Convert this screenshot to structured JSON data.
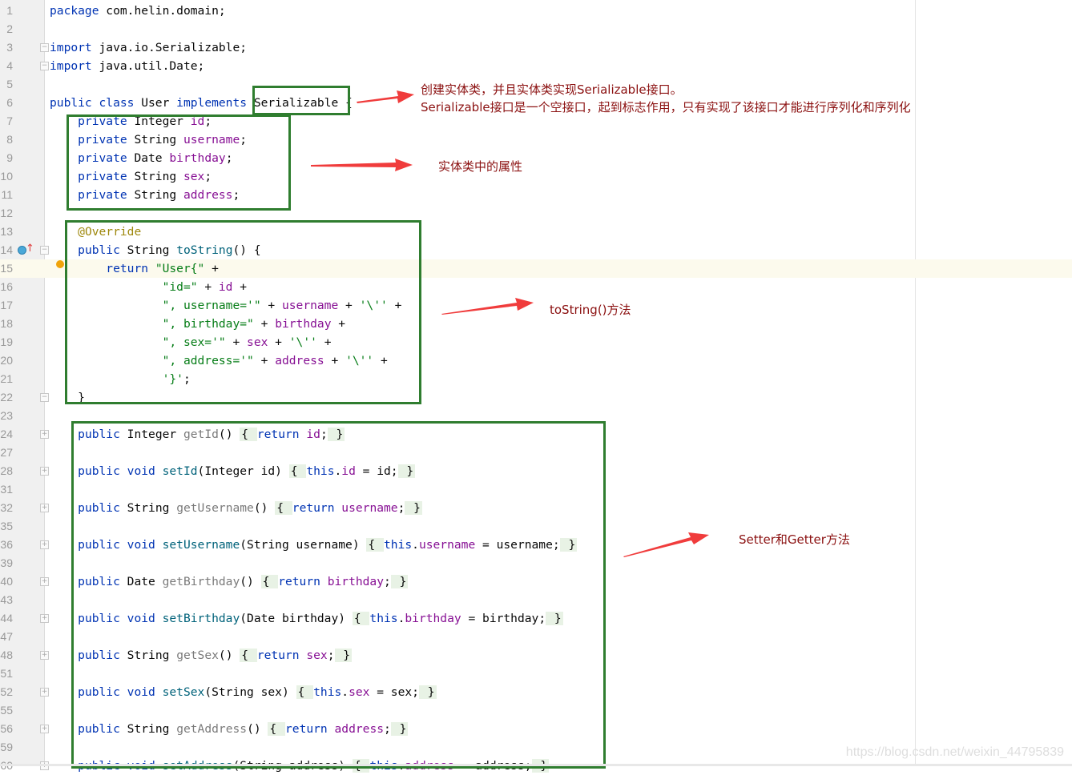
{
  "editor": {
    "caret_line": "15",
    "lines": [
      {
        "n": "1",
        "t": [
          [
            "k",
            "package "
          ],
          [
            "p",
            "com.helin.domain;"
          ]
        ]
      },
      {
        "n": "2",
        "t": []
      },
      {
        "n": "3",
        "fold": "-",
        "t": [
          [
            "k",
            "import "
          ],
          [
            "p",
            "java.io.Serializable;"
          ]
        ]
      },
      {
        "n": "4",
        "fold": "-",
        "t": [
          [
            "k",
            "import "
          ],
          [
            "p",
            "java.util.Date;"
          ]
        ]
      },
      {
        "n": "5",
        "t": []
      },
      {
        "n": "6",
        "t": [
          [
            "k",
            "public class "
          ],
          [
            "p",
            "User "
          ],
          [
            "k",
            "implements "
          ],
          [
            "p",
            "Serializable {"
          ]
        ]
      },
      {
        "n": "7",
        "t": [
          [
            "p",
            "    "
          ],
          [
            "k",
            "private "
          ],
          [
            "p",
            "Integer "
          ],
          [
            "f",
            "id"
          ],
          [
            "p",
            ";"
          ]
        ]
      },
      {
        "n": "8",
        "t": [
          [
            "p",
            "    "
          ],
          [
            "k",
            "private "
          ],
          [
            "p",
            "String "
          ],
          [
            "f",
            "username"
          ],
          [
            "p",
            ";"
          ]
        ]
      },
      {
        "n": "9",
        "t": [
          [
            "p",
            "    "
          ],
          [
            "k",
            "private "
          ],
          [
            "p",
            "Date "
          ],
          [
            "f",
            "birthday"
          ],
          [
            "p",
            ";"
          ]
        ]
      },
      {
        "n": "10",
        "t": [
          [
            "p",
            "    "
          ],
          [
            "k",
            "private "
          ],
          [
            "p",
            "String "
          ],
          [
            "f",
            "sex"
          ],
          [
            "p",
            ";"
          ]
        ]
      },
      {
        "n": "11",
        "t": [
          [
            "p",
            "    "
          ],
          [
            "k",
            "private "
          ],
          [
            "p",
            "String "
          ],
          [
            "f",
            "address"
          ],
          [
            "p",
            ";"
          ]
        ]
      },
      {
        "n": "12",
        "t": []
      },
      {
        "n": "13",
        "t": [
          [
            "p",
            "    "
          ],
          [
            "a",
            "@Override"
          ]
        ]
      },
      {
        "n": "14",
        "fold": "-",
        "t": [
          [
            "p",
            "    "
          ],
          [
            "k",
            "public "
          ],
          [
            "p",
            "String "
          ],
          [
            "m",
            "toString"
          ],
          [
            "p",
            "() {"
          ]
        ]
      },
      {
        "n": "15",
        "t": [
          [
            "p",
            "        "
          ],
          [
            "k",
            "return "
          ],
          [
            "s",
            "\"User{\""
          ],
          [
            "p",
            " +"
          ]
        ]
      },
      {
        "n": "16",
        "t": [
          [
            "p",
            "                "
          ],
          [
            "s",
            "\"id=\""
          ],
          [
            "p",
            " + "
          ],
          [
            "f",
            "id"
          ],
          [
            "p",
            " +"
          ]
        ]
      },
      {
        "n": "17",
        "t": [
          [
            "p",
            "                "
          ],
          [
            "s",
            "\", username='\""
          ],
          [
            "p",
            " + "
          ],
          [
            "f",
            "username"
          ],
          [
            "p",
            " + "
          ],
          [
            "s",
            "'\\''"
          ],
          [
            "p",
            " +"
          ]
        ]
      },
      {
        "n": "18",
        "t": [
          [
            "p",
            "                "
          ],
          [
            "s",
            "\", birthday=\""
          ],
          [
            "p",
            " + "
          ],
          [
            "f",
            "birthday"
          ],
          [
            "p",
            " +"
          ]
        ]
      },
      {
        "n": "19",
        "t": [
          [
            "p",
            "                "
          ],
          [
            "s",
            "\", sex='\""
          ],
          [
            "p",
            " + "
          ],
          [
            "f",
            "sex"
          ],
          [
            "p",
            " + "
          ],
          [
            "s",
            "'\\''"
          ],
          [
            "p",
            " +"
          ]
        ]
      },
      {
        "n": "20",
        "t": [
          [
            "p",
            "                "
          ],
          [
            "s",
            "\", address='\""
          ],
          [
            "p",
            " + "
          ],
          [
            "f",
            "address"
          ],
          [
            "p",
            " + "
          ],
          [
            "s",
            "'\\''"
          ],
          [
            "p",
            " +"
          ]
        ]
      },
      {
        "n": "21",
        "t": [
          [
            "p",
            "                "
          ],
          [
            "s",
            "'}'"
          ],
          [
            "p",
            ";"
          ]
        ]
      },
      {
        "n": "22",
        "fold": "-",
        "t": [
          [
            "p",
            "    }"
          ]
        ]
      },
      {
        "n": "23",
        "t": []
      },
      {
        "n": "24",
        "fold": "+",
        "t": [
          [
            "p",
            "    "
          ],
          [
            "k",
            "public "
          ],
          [
            "p",
            "Integer "
          ],
          [
            "g",
            "getId"
          ],
          [
            "p",
            "() "
          ],
          [
            "b",
            "{ "
          ],
          [
            "k",
            "return "
          ],
          [
            "f",
            "id"
          ],
          [
            "p",
            ";"
          ],
          [
            "b",
            " }"
          ]
        ]
      },
      {
        "n": "27",
        "t": []
      },
      {
        "n": "28",
        "fold": "+",
        "t": [
          [
            "p",
            "    "
          ],
          [
            "k",
            "public void "
          ],
          [
            "m",
            "setId"
          ],
          [
            "p",
            "(Integer id) "
          ],
          [
            "b",
            "{ "
          ],
          [
            "k",
            "this"
          ],
          [
            "p",
            "."
          ],
          [
            "f",
            "id"
          ],
          [
            "p",
            " = id;"
          ],
          [
            "b",
            " }"
          ]
        ]
      },
      {
        "n": "31",
        "t": []
      },
      {
        "n": "32",
        "fold": "+",
        "t": [
          [
            "p",
            "    "
          ],
          [
            "k",
            "public "
          ],
          [
            "p",
            "String "
          ],
          [
            "g",
            "getUsername"
          ],
          [
            "p",
            "() "
          ],
          [
            "b",
            "{ "
          ],
          [
            "k",
            "return "
          ],
          [
            "f",
            "username"
          ],
          [
            "p",
            ";"
          ],
          [
            "b",
            " }"
          ]
        ]
      },
      {
        "n": "35",
        "t": []
      },
      {
        "n": "36",
        "fold": "+",
        "t": [
          [
            "p",
            "    "
          ],
          [
            "k",
            "public void "
          ],
          [
            "m",
            "setUsername"
          ],
          [
            "p",
            "(String username) "
          ],
          [
            "b",
            "{ "
          ],
          [
            "k",
            "this"
          ],
          [
            "p",
            "."
          ],
          [
            "f",
            "username"
          ],
          [
            "p",
            " = username;"
          ],
          [
            "b",
            " }"
          ]
        ]
      },
      {
        "n": "39",
        "t": []
      },
      {
        "n": "40",
        "fold": "+",
        "t": [
          [
            "p",
            "    "
          ],
          [
            "k",
            "public "
          ],
          [
            "p",
            "Date "
          ],
          [
            "g",
            "getBirthday"
          ],
          [
            "p",
            "() "
          ],
          [
            "b",
            "{ "
          ],
          [
            "k",
            "return "
          ],
          [
            "f",
            "birthday"
          ],
          [
            "p",
            ";"
          ],
          [
            "b",
            " }"
          ]
        ]
      },
      {
        "n": "43",
        "t": []
      },
      {
        "n": "44",
        "fold": "+",
        "t": [
          [
            "p",
            "    "
          ],
          [
            "k",
            "public void "
          ],
          [
            "m",
            "setBirthday"
          ],
          [
            "p",
            "(Date birthday) "
          ],
          [
            "b",
            "{ "
          ],
          [
            "k",
            "this"
          ],
          [
            "p",
            "."
          ],
          [
            "f",
            "birthday"
          ],
          [
            "p",
            " = birthday;"
          ],
          [
            "b",
            " }"
          ]
        ]
      },
      {
        "n": "47",
        "t": []
      },
      {
        "n": "48",
        "fold": "+",
        "t": [
          [
            "p",
            "    "
          ],
          [
            "k",
            "public "
          ],
          [
            "p",
            "String "
          ],
          [
            "g",
            "getSex"
          ],
          [
            "p",
            "() "
          ],
          [
            "b",
            "{ "
          ],
          [
            "k",
            "return "
          ],
          [
            "f",
            "sex"
          ],
          [
            "p",
            ";"
          ],
          [
            "b",
            " }"
          ]
        ]
      },
      {
        "n": "51",
        "t": []
      },
      {
        "n": "52",
        "fold": "+",
        "t": [
          [
            "p",
            "    "
          ],
          [
            "k",
            "public void "
          ],
          [
            "m",
            "setSex"
          ],
          [
            "p",
            "(String sex) "
          ],
          [
            "b",
            "{ "
          ],
          [
            "k",
            "this"
          ],
          [
            "p",
            "."
          ],
          [
            "f",
            "sex"
          ],
          [
            "p",
            " = sex;"
          ],
          [
            "b",
            " }"
          ]
        ]
      },
      {
        "n": "55",
        "t": []
      },
      {
        "n": "56",
        "fold": "+",
        "t": [
          [
            "p",
            "    "
          ],
          [
            "k",
            "public "
          ],
          [
            "p",
            "String "
          ],
          [
            "g",
            "getAddress"
          ],
          [
            "p",
            "() "
          ],
          [
            "b",
            "{ "
          ],
          [
            "k",
            "return "
          ],
          [
            "f",
            "address"
          ],
          [
            "p",
            ";"
          ],
          [
            "b",
            " }"
          ]
        ]
      },
      {
        "n": "59",
        "t": []
      },
      {
        "n": "60",
        "fold": "+",
        "t": [
          [
            "p",
            "    "
          ],
          [
            "k",
            "public void "
          ],
          [
            "m",
            "setAddress"
          ],
          [
            "p",
            "(String address) "
          ],
          [
            "b",
            "{ "
          ],
          [
            "k",
            "this"
          ],
          [
            "p",
            "."
          ],
          [
            "f",
            "address"
          ],
          [
            "p",
            " = address;"
          ],
          [
            "b",
            " }"
          ]
        ]
      }
    ]
  },
  "annotations": {
    "serializable_line1": "创建实体类，并且实体类实现Serializable接口。",
    "serializable_line2": "Serializable接口是一个空接口，起到标志作用，只有实现了该接口才能进行序列化和序列化",
    "fields": "实体类中的属性",
    "tostring": "toString()方法",
    "getset": "Setter和Getter方法"
  },
  "colors": {
    "box": "#2f7d2f",
    "arrow": "#f03c3c",
    "note": "#8b1010",
    "keyword": "#0033b3",
    "field": "#871094",
    "string": "#067d17"
  },
  "watermark": "https://blog.csdn.net/weixin_44795839"
}
